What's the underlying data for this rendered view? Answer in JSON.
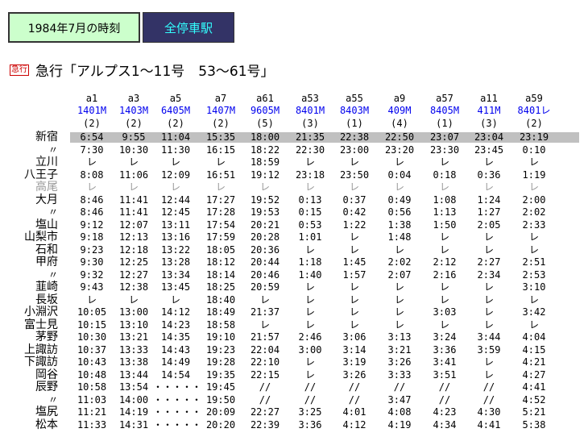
{
  "header": {
    "period_label": "1984年7月の時刻",
    "station_button": "全停車駅"
  },
  "train": {
    "icon_label": "急行",
    "title": "急行「アルプス1～11号　53～61号」"
  },
  "colors": {
    "highlight": "#c0c0c0",
    "link_blue": "#0000ee",
    "button_bg": "#333366",
    "button_text": "#33ffff",
    "period_bg": "#ccffcc"
  },
  "columns": [
    {
      "id": "a1",
      "no": "1401M",
      "cars": "(2)"
    },
    {
      "id": "a3",
      "no": "1403M",
      "cars": "(2)"
    },
    {
      "id": "a5",
      "no": "6405M",
      "cars": "(2)"
    },
    {
      "id": "a7",
      "no": "1407M",
      "cars": "(2)"
    },
    {
      "id": "a61",
      "no": "9605M",
      "cars": "(5)"
    },
    {
      "id": "a53",
      "no": "8401M",
      "cars": "(3)"
    },
    {
      "id": "a55",
      "no": "8403M",
      "cars": "(1)"
    },
    {
      "id": "a9",
      "no": "409M",
      "cars": "(4)"
    },
    {
      "id": "a57",
      "no": "8405M",
      "cars": "(1)"
    },
    {
      "id": "a11",
      "no": "411M",
      "cars": "(3)"
    },
    {
      "id": "a59",
      "no": "8401レ",
      "cars": "(2)"
    }
  ],
  "rows": [
    {
      "name": "新宿",
      "type": "station",
      "highlight": true,
      "times": [
        "6:54",
        "9:55",
        "11:04",
        "15:35",
        "18:00",
        "21:35",
        "22:38",
        "22:50",
        "23:07",
        "23:04",
        "23:19"
      ]
    },
    {
      "name": "〃",
      "type": "sub",
      "times": [
        "7:30",
        "10:30",
        "11:30",
        "16:15",
        "18:22",
        "22:30",
        "23:00",
        "23:20",
        "23:30",
        "23:45",
        "0:10"
      ]
    },
    {
      "name": "立川",
      "type": "station",
      "times": [
        "レ",
        "レ",
        "レ",
        "レ",
        "18:59",
        "レ",
        "レ",
        "レ",
        "レ",
        "レ",
        "レ"
      ]
    },
    {
      "name": "八王子",
      "type": "station",
      "times": [
        "8:08",
        "11:06",
        "12:09",
        "16:51",
        "19:12",
        "23:18",
        "23:50",
        "0:04",
        "0:18",
        "0:36",
        "1:19"
      ]
    },
    {
      "name": "高尾",
      "type": "station",
      "gray": true,
      "times": [
        "レ",
        "レ",
        "レ",
        "レ",
        "レ",
        "レ",
        "レ",
        "レ",
        "レ",
        "レ",
        "レ"
      ]
    },
    {
      "name": "大月",
      "type": "station",
      "times": [
        "8:46",
        "11:41",
        "12:44",
        "17:27",
        "19:52",
        "0:13",
        "0:37",
        "0:49",
        "1:08",
        "1:24",
        "2:00"
      ]
    },
    {
      "name": "〃",
      "type": "sub",
      "times": [
        "8:46",
        "11:41",
        "12:45",
        "17:28",
        "19:53",
        "0:15",
        "0:42",
        "0:56",
        "1:13",
        "1:27",
        "2:02"
      ]
    },
    {
      "name": "塩山",
      "type": "station",
      "times": [
        "9:12",
        "12:07",
        "13:11",
        "17:54",
        "20:21",
        "0:53",
        "1:22",
        "1:38",
        "1:50",
        "2:05",
        "2:33"
      ]
    },
    {
      "name": "山梨市",
      "type": "station",
      "times": [
        "9:18",
        "12:13",
        "13:16",
        "17:59",
        "20:28",
        "1:01",
        "レ",
        "1:48",
        "レ",
        "レ",
        "レ"
      ]
    },
    {
      "name": "石和",
      "type": "station",
      "times": [
        "9:23",
        "12:18",
        "13:22",
        "18:05",
        "20:36",
        "レ",
        "レ",
        "レ",
        "レ",
        "レ",
        "レ"
      ]
    },
    {
      "name": "甲府",
      "type": "station",
      "times": [
        "9:30",
        "12:25",
        "13:28",
        "18:12",
        "20:44",
        "1:18",
        "1:45",
        "2:02",
        "2:12",
        "2:27",
        "2:51"
      ]
    },
    {
      "name": "〃",
      "type": "sub",
      "times": [
        "9:32",
        "12:27",
        "13:34",
        "18:14",
        "20:46",
        "1:40",
        "1:57",
        "2:07",
        "2:16",
        "2:34",
        "2:53"
      ]
    },
    {
      "name": "韮崎",
      "type": "station",
      "times": [
        "9:43",
        "12:38",
        "13:45",
        "18:25",
        "20:59",
        "レ",
        "レ",
        "レ",
        "レ",
        "レ",
        "3:10"
      ]
    },
    {
      "name": "長坂",
      "type": "station",
      "times": [
        "レ",
        "レ",
        "レ",
        "18:40",
        "レ",
        "レ",
        "レ",
        "レ",
        "レ",
        "レ",
        "レ"
      ]
    },
    {
      "name": "小淵沢",
      "type": "station",
      "times": [
        "10:05",
        "13:00",
        "14:12",
        "18:49",
        "21:37",
        "レ",
        "レ",
        "レ",
        "3:03",
        "レ",
        "3:42"
      ]
    },
    {
      "name": "富士見",
      "type": "station",
      "times": [
        "10:15",
        "13:10",
        "14:23",
        "18:58",
        "レ",
        "レ",
        "レ",
        "レ",
        "レ",
        "レ",
        "レ"
      ]
    },
    {
      "name": "茅野",
      "type": "station",
      "times": [
        "10:30",
        "13:21",
        "14:35",
        "19:10",
        "21:57",
        "2:46",
        "3:06",
        "3:13",
        "3:24",
        "3:44",
        "4:04"
      ]
    },
    {
      "name": "上諏訪",
      "type": "station",
      "times": [
        "10:37",
        "13:33",
        "14:43",
        "19:23",
        "22:04",
        "3:00",
        "3:14",
        "3:21",
        "3:36",
        "3:59",
        "4:15"
      ]
    },
    {
      "name": "下諏訪",
      "type": "station",
      "times": [
        "10:43",
        "13:38",
        "14:49",
        "19:28",
        "22:10",
        "レ",
        "3:19",
        "3:26",
        "3:41",
        "レ",
        "4:21"
      ]
    },
    {
      "name": "岡谷",
      "type": "station",
      "times": [
        "10:48",
        "13:44",
        "14:54",
        "19:35",
        "22:15",
        "レ",
        "3:26",
        "3:33",
        "3:51",
        "レ",
        "4:27"
      ]
    },
    {
      "name": "辰野",
      "type": "station",
      "times": [
        "10:58",
        "13:54",
        "・・・・・",
        "19:45",
        "//",
        "//",
        "//",
        "//",
        "//",
        "//",
        "4:41"
      ]
    },
    {
      "name": "〃",
      "type": "sub",
      "times": [
        "11:03",
        "14:00",
        "・・・・・",
        "19:50",
        "//",
        "//",
        "//",
        "3:47",
        "//",
        "//",
        "4:52"
      ]
    },
    {
      "name": "塩尻",
      "type": "station",
      "times": [
        "11:21",
        "14:19",
        "・・・・・",
        "20:09",
        "22:27",
        "3:25",
        "4:01",
        "4:08",
        "4:23",
        "4:30",
        "5:21"
      ]
    },
    {
      "name": "松本",
      "type": "station",
      "times": [
        "11:33",
        "14:31",
        "・・・・・",
        "20:20",
        "22:39",
        "3:36",
        "4:12",
        "4:19",
        "4:34",
        "4:41",
        "5:38"
      ]
    }
  ]
}
